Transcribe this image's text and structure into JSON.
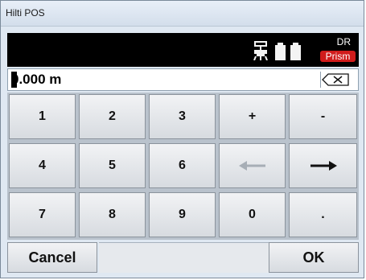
{
  "window": {
    "title": "Hilti POS"
  },
  "status": {
    "mode_code": "DR",
    "target_label": "Prism",
    "icons": [
      "tilt-sensor-icon",
      "battery-icon",
      "battery-icon"
    ]
  },
  "input": {
    "value": "0.000 m"
  },
  "keypad": {
    "rows": [
      [
        "1",
        "2",
        "3",
        "+",
        "-"
      ],
      [
        "4",
        "5",
        "6",
        "left-arrow-icon",
        "right-arrow-icon"
      ],
      [
        "7",
        "8",
        "9",
        "0",
        "."
      ]
    ]
  },
  "footer": {
    "cancel_label": "Cancel",
    "ok_label": "OK"
  },
  "colors": {
    "status_bar": "#000000",
    "prism_badge": "#d11c1c",
    "key_face": "#e6e9ed"
  }
}
